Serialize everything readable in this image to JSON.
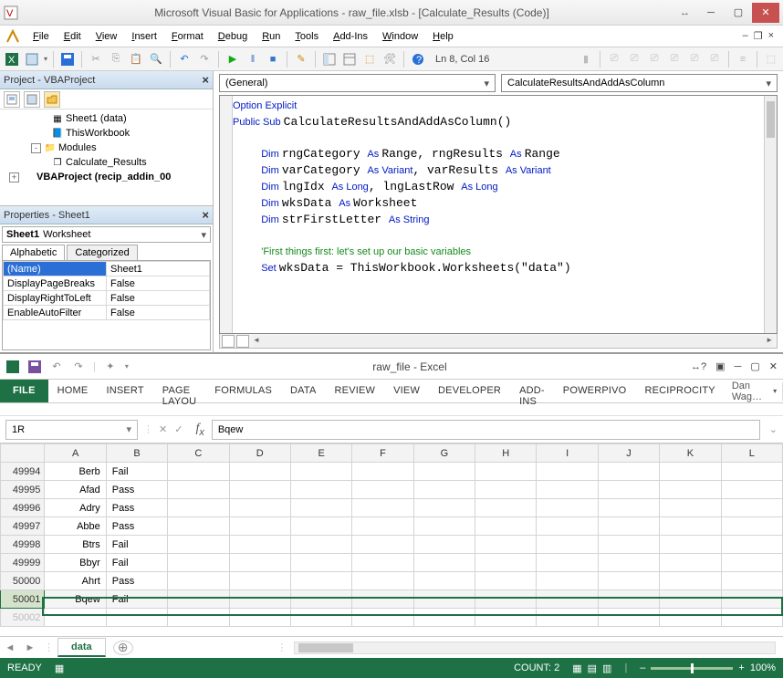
{
  "vba": {
    "title": "Microsoft Visual Basic for Applications - raw_file.xlsb - [Calculate_Results (Code)]",
    "menus": [
      "File",
      "Edit",
      "View",
      "Insert",
      "Format",
      "Debug",
      "Run",
      "Tools",
      "Add-Ins",
      "Window",
      "Help"
    ],
    "cursor_status": "Ln 8, Col 16",
    "project_pane_title": "Project - VBAProject",
    "project_tree": [
      {
        "indent": 52,
        "icon": "sheet-icon",
        "label": "Sheet1 (data)"
      },
      {
        "indent": 52,
        "icon": "book-icon",
        "label": "ThisWorkbook"
      },
      {
        "indent": 30,
        "twist": "-",
        "icon": "folder-icon",
        "label": "Modules"
      },
      {
        "indent": 52,
        "icon": "module-icon",
        "label": "Calculate_Results"
      },
      {
        "indent": 6,
        "twist": "+",
        "icon": "project-icon",
        "label": "VBAProject (recip_addin_00",
        "bold": true
      }
    ],
    "props_pane_title": "Properties - Sheet1",
    "props_object_name": "Sheet1",
    "props_object_type": "Worksheet",
    "props_tabs": [
      "Alphabetic",
      "Categorized"
    ],
    "props_rows": [
      {
        "k": "(Name)",
        "v": "Sheet1",
        "sel": true
      },
      {
        "k": "DisplayPageBreaks",
        "v": "False"
      },
      {
        "k": "DisplayRightToLeft",
        "v": "False"
      },
      {
        "k": "EnableAutoFilter",
        "v": "False"
      }
    ],
    "code_dd_left": "(General)",
    "code_dd_right": "CalculateResultsAndAddAsColumn",
    "code_lines": [
      {
        "t": "Option Explicit",
        "cls": "kw"
      },
      {
        "t": "Public Sub CalculateResultsAndAddAsColumn()",
        "pre": "",
        "segs": [
          [
            "kw",
            "Public Sub "
          ],
          [
            "",
            "CalculateResultsAndAddAsColumn()"
          ]
        ]
      },
      {
        "t": ""
      },
      {
        "segs": [
          [
            "",
            "    "
          ],
          [
            "kw",
            "Dim "
          ],
          [
            "",
            "rngCategory "
          ],
          [
            "kw",
            "As "
          ],
          [
            "",
            "Range, rngResults "
          ],
          [
            "kw",
            "As "
          ],
          [
            "",
            "Range"
          ]
        ]
      },
      {
        "segs": [
          [
            "",
            "    "
          ],
          [
            "kw",
            "Dim "
          ],
          [
            "",
            "varCategory "
          ],
          [
            "kw",
            "As Variant"
          ],
          [
            "",
            ", varResults "
          ],
          [
            "kw",
            "As Variant"
          ]
        ]
      },
      {
        "segs": [
          [
            "",
            "    "
          ],
          [
            "kw",
            "Dim "
          ],
          [
            "",
            "lngIdx "
          ],
          [
            "kw",
            "As Long"
          ],
          [
            "",
            ", lngLastRow "
          ],
          [
            "kw",
            "As Long"
          ]
        ]
      },
      {
        "segs": [
          [
            "",
            "    "
          ],
          [
            "kw",
            "Dim "
          ],
          [
            "",
            "wksData "
          ],
          [
            "kw",
            "As "
          ],
          [
            "",
            "Worksheet"
          ]
        ]
      },
      {
        "segs": [
          [
            "",
            "    "
          ],
          [
            "kw",
            "Dim "
          ],
          [
            "",
            "strFirstLetter "
          ],
          [
            "kw",
            "As String"
          ]
        ]
      },
      {
        "t": "    "
      },
      {
        "segs": [
          [
            "",
            "    "
          ],
          [
            "cm",
            "'First things first: let's set up our basic variables"
          ]
        ]
      },
      {
        "segs": [
          [
            "",
            "    "
          ],
          [
            "kw",
            "Set "
          ],
          [
            "",
            "wksData = ThisWorkbook.Worksheets(\"data\")"
          ]
        ]
      }
    ]
  },
  "excel": {
    "title": "raw_file - Excel",
    "ribbon_tabs": [
      "FILE",
      "HOME",
      "INSERT",
      "PAGE LAYOU",
      "FORMULAS",
      "DATA",
      "REVIEW",
      "VIEW",
      "DEVELOPER",
      "ADD-INS",
      "POWERPIVO",
      "RECIPROCITY"
    ],
    "user": "Dan Wag…",
    "namebox": "1R",
    "formula": "Bqew",
    "columns": [
      "A",
      "B",
      "C",
      "D",
      "E",
      "F",
      "G",
      "H",
      "I",
      "J",
      "K",
      "L"
    ],
    "rows": [
      {
        "n": "49994",
        "a": "Berb",
        "b": "Fail"
      },
      {
        "n": "49995",
        "a": "Afad",
        "b": "Pass"
      },
      {
        "n": "49996",
        "a": "Adry",
        "b": "Pass"
      },
      {
        "n": "49997",
        "a": "Abbe",
        "b": "Pass"
      },
      {
        "n": "49998",
        "a": "Btrs",
        "b": "Fail"
      },
      {
        "n": "49999",
        "a": "Bbyr",
        "b": "Fail"
      },
      {
        "n": "50000",
        "a": "Ahrt",
        "b": "Pass"
      },
      {
        "n": "50001",
        "a": "Bqew",
        "b": "Fail",
        "sel": true
      }
    ],
    "sheet_tab": "data",
    "status_ready": "READY",
    "status_count_label": "COUNT:",
    "status_count_value": "2",
    "zoom": "100%"
  }
}
